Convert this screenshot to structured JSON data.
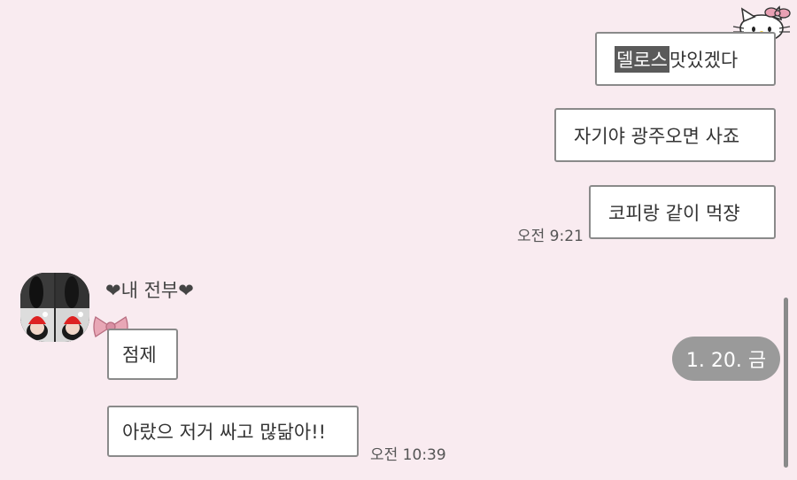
{
  "messages_out": [
    {
      "highlight": "델로스",
      "text": " 맛있겠다"
    },
    {
      "text": "자기야 광주오면 사죠"
    },
    {
      "text": "코피랑 같이 먹쟝"
    }
  ],
  "out_time": "오전 9:21",
  "sender_name": "❤내 전부❤",
  "messages_in": [
    {
      "text": "점제"
    },
    {
      "text": "아랐으 저거 싸고 많닮아!!"
    }
  ],
  "in_time": "오전 10:39",
  "date_pill": "1. 20. 금",
  "colors": {
    "background": "#f9ebf0",
    "bubble_border": "#8a8a8a",
    "highlight": "#5a5a5a",
    "bow": "#d98fa3",
    "date_pill": "#9a9a9a"
  },
  "icons": [
    "hello-kitty-sticker-icon",
    "pink-bow-icon",
    "profile-photo"
  ]
}
